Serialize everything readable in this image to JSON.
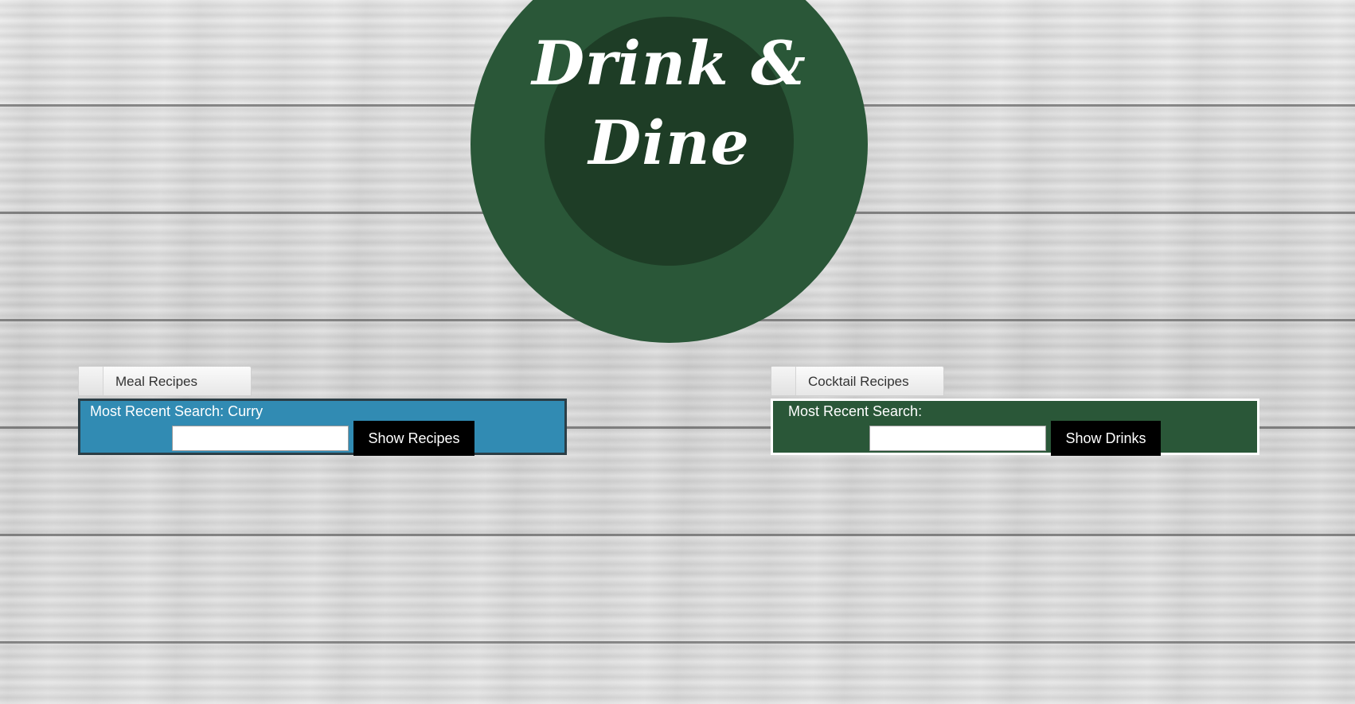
{
  "logo": {
    "title": "Drink & Dine"
  },
  "meal": {
    "tab_label": "Meal Recipes",
    "recent_label": "Most Recent Search: Curry",
    "input_value": "",
    "input_placeholder": "",
    "button_label": "Show Recipes"
  },
  "drink": {
    "tab_label": "Cocktail Recipes",
    "recent_label": "Most Recent Search:",
    "input_value": "",
    "input_placeholder": "",
    "button_label": "Show Drinks"
  },
  "colors": {
    "logo_outer": "#2a5738",
    "logo_inner": "#1e3d26",
    "meal_panel": "#318bb3",
    "drink_panel": "#2a5738",
    "button": "#000000"
  }
}
